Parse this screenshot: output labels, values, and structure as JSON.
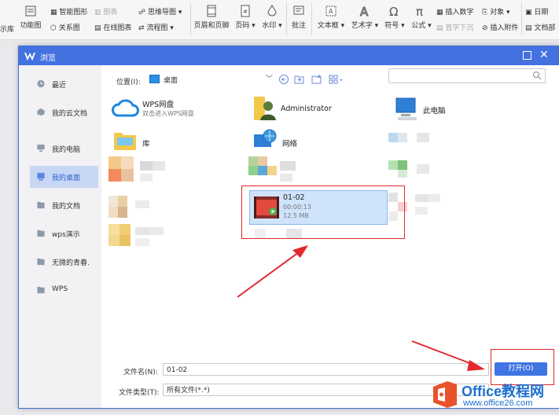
{
  "ribbon": {
    "left_cut": "示库",
    "func_graph": "功能图",
    "smart_shape": "智能图形",
    "chart": "图表",
    "mindmap": "思维导图",
    "relation": "关系图",
    "online_chart": "在线图表",
    "flowchart": "流程图",
    "header_footer": "页眉和页脚",
    "page_number": "页码",
    "watermark": "水印",
    "annotation": "批注",
    "textbox": "文本框",
    "art_text": "艺术字",
    "symbol": "符号",
    "formula": "公式",
    "insert_number": "插入数字",
    "object": "对象",
    "date": "日期",
    "drop_cap": "首字下沉",
    "insert_attachment": "插入附件",
    "doc_part": "文档部"
  },
  "dialog": {
    "title": "浏览",
    "sidebar": [
      {
        "label": "最近"
      },
      {
        "label": "我的云文档"
      },
      {
        "label": "我的电脑"
      },
      {
        "label": "我的桌面"
      },
      {
        "label": "我的文档"
      },
      {
        "label": "wps演示"
      },
      {
        "label": "无微的青春."
      },
      {
        "label": "WPS"
      }
    ],
    "location_label": "位置(I):",
    "location_value": "桌面",
    "files": {
      "wps_cloud": {
        "name": "WPS网盘",
        "sub": "双击进入WPS网盘"
      },
      "admin": {
        "name": "Administrator"
      },
      "pc": {
        "name": "此电脑"
      },
      "library": {
        "name": "库"
      },
      "network": {
        "name": "网络"
      },
      "video": {
        "name": "01-02",
        "duration": "00:00:13",
        "size": "12.5 MB"
      }
    },
    "filename_label": "文件名(N):",
    "filename_value": "01-02",
    "filetype_label": "文件类型(T):",
    "filetype_value": "所有文件(*.*)",
    "open_label": "打开(O)"
  },
  "watermark": {
    "brand": "Office教程网",
    "url": "www.office26.com"
  },
  "colors": {
    "accent": "#4471e0",
    "highlight": "#e3282d"
  }
}
